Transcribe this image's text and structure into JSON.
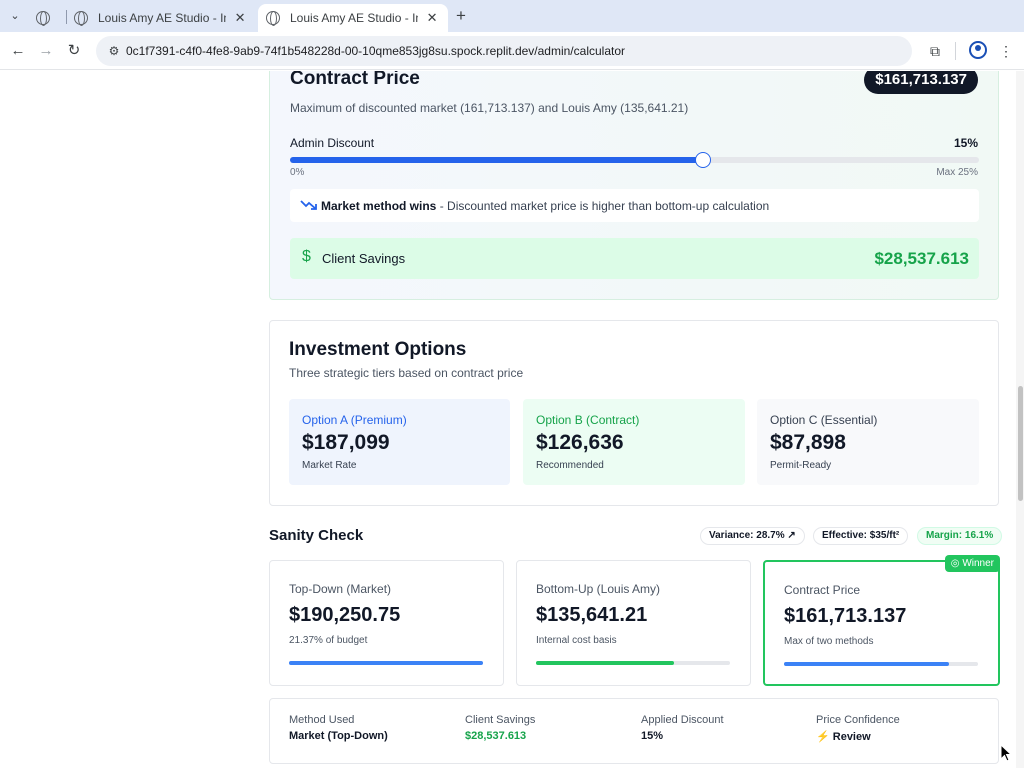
{
  "browser": {
    "tabs": [
      {
        "title": "Louis Amy AE Studio - Intera",
        "active": false
      },
      {
        "title": "Louis Amy AE Studio - Intera",
        "active": true
      }
    ],
    "url": "0c1f7391-c4f0-4fe8-9ab9-74f1b548228d-00-10qme853jg8su.spock.replit.dev/admin/calculator"
  },
  "contract": {
    "title": "Contract Price",
    "badge": "$161,713.137",
    "subtitle": "Maximum of discounted market (161,713.137) and Louis Amy (135,641.21)",
    "discount_label": "Admin Discount",
    "discount_value": "15%",
    "discount_fraction": 0.6,
    "slider_min": "0%",
    "slider_max": "Max 25%",
    "method_strong": "Market method wins",
    "method_rest": " - Discounted market price is higher than bottom-up calculation",
    "savings_label": "Client Savings",
    "savings_value": "$28,537.613"
  },
  "investment": {
    "title": "Investment Options",
    "subtitle": "Three strategic tiers based on contract price",
    "options": [
      {
        "name": "Option A (Premium)",
        "price": "$187,099",
        "tag": "Market Rate",
        "name_color": "#2563eb",
        "bg": "#eff4fd"
      },
      {
        "name": "Option B (Contract)",
        "price": "$126,636",
        "tag": "Recommended",
        "name_color": "#16a34a",
        "bg": "#ecfdf3"
      },
      {
        "name": "Option C (Essential)",
        "price": "$87,898",
        "tag": "Permit-Ready",
        "name_color": "#374151",
        "bg": "#f8f9fb"
      }
    ]
  },
  "sanity": {
    "title": "Sanity Check",
    "pills": {
      "variance": "Variance: 28.7% ↗",
      "effective": "Effective: $35/ft²",
      "margin": "Margin: 16.1%"
    },
    "metrics": [
      {
        "label": "Top-Down (Market)",
        "value": "$190,250.75",
        "note": "21.37% of budget",
        "fill": 1.0,
        "color": "#3b82f6"
      },
      {
        "label": "Bottom-Up (Louis Amy)",
        "value": "$135,641.21",
        "note": "Internal cost basis",
        "fill": 0.71,
        "color": "#22c55e"
      },
      {
        "label": "Contract Price",
        "value": "$161,713.137",
        "note": "Max of two methods",
        "fill": 0.85,
        "color": "#3b82f6"
      }
    ],
    "winner_label": "Winner"
  },
  "summary": [
    {
      "label": "Method Used",
      "value": "Market (Top-Down)",
      "color": "#111827"
    },
    {
      "label": "Client Savings",
      "value": "$28,537.613",
      "color": "#16a34a"
    },
    {
      "label": "Applied Discount",
      "value": "15%",
      "color": "#111827"
    },
    {
      "label": "Price Confidence",
      "value": "⚡ Review",
      "color": "#111827"
    }
  ],
  "colors": {
    "accent": "#2563eb",
    "success": "#16a34a",
    "dark": "#111827"
  }
}
